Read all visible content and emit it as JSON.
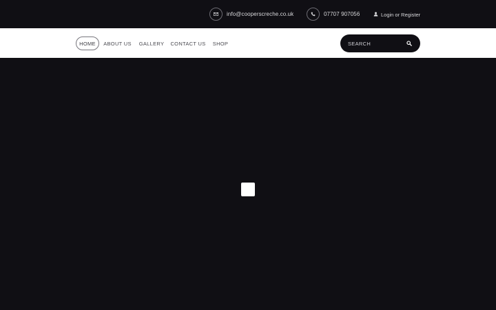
{
  "topbar": {
    "email": "info@cooperscreche.co.uk",
    "phone": "07707 907056",
    "account": "Login or Register",
    "icons": {
      "email": "envelope-icon",
      "phone": "phone-icon",
      "account": "user-icon"
    }
  },
  "nav": {
    "items": [
      {
        "label": "HOME",
        "active": true
      },
      {
        "label": "ABOUT US",
        "active": false
      },
      {
        "label": "GALLERY",
        "active": false
      },
      {
        "label": "CONTACT US",
        "active": false
      },
      {
        "label": "SHOP",
        "active": false
      }
    ]
  },
  "search": {
    "placeholder": "SEARCH",
    "icon": "search-icon"
  },
  "colors": {
    "background": "#100f14",
    "nav_background": "#ffffff",
    "loader": "#ffffff"
  }
}
